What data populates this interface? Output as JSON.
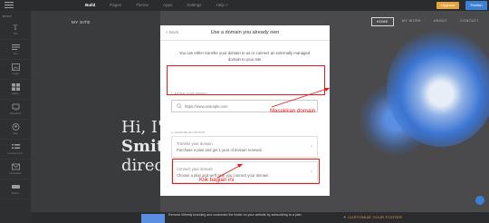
{
  "topbar": {
    "tabs": [
      {
        "label": "Build",
        "active": true
      },
      {
        "label": "Pages",
        "active": false
      },
      {
        "label": "Theme",
        "active": false
      },
      {
        "label": "Apps",
        "active": false
      },
      {
        "label": "Settings",
        "active": false
      },
      {
        "label": "Help ˅",
        "active": false
      }
    ],
    "upgrade_label": "Upgrade",
    "publish_label": "Publish"
  },
  "sidebar": {
    "header": "BASIC",
    "items": [
      {
        "icon": "text-icon",
        "label": "Title"
      },
      {
        "icon": "paragraph-icon",
        "label": "Text"
      },
      {
        "icon": "image-icon",
        "label": "Image"
      },
      {
        "icon": "gallery-icon",
        "label": "Gallery"
      },
      {
        "icon": "slideshow-icon",
        "label": "Slideshow"
      },
      {
        "icon": "map-icon",
        "label": "Map"
      },
      {
        "icon": "form-icon",
        "label": "Contact Form"
      },
      {
        "icon": "newsletter-icon",
        "label": "Newsletter"
      },
      {
        "icon": "button-icon",
        "label": "Button"
      }
    ]
  },
  "site": {
    "title": "MY SITE",
    "nav": [
      {
        "label": "HOME",
        "active": true
      },
      {
        "label": "MY WORK",
        "active": false
      },
      {
        "label": "ABOUT",
        "active": false
      },
      {
        "label": "CONTACT",
        "active": false
      }
    ],
    "hero_line1": "Hi, I'",
    "hero_line2": "Smit",
    "hero_line3": "direc"
  },
  "modal": {
    "back_label": "< Back",
    "title": "Use a domain you already own",
    "intro": "You can either transfer your domain to us or connect an externally managed domain to your site",
    "section1_label": "1. ENTER YOUR DOMAIN",
    "input_placeholder": "https://www.example.com",
    "section2_label": "2. CHOOSE AN OPTION",
    "options": [
      {
        "title": "Transfer your domain",
        "desc": "Purchase a plan and get 1 year of domain renewal."
      },
      {
        "title": "Connect your domain",
        "desc": "Choose a plan and we'll help you connect your domain."
      }
    ]
  },
  "annotations": {
    "masukkan": "Masukkan domain",
    "klik": "Klik bagian ini",
    "color": "#e41b1b"
  },
  "footer": {
    "text": "Remove Weebly branding and customize the footer on your website by subscribing to a plan.",
    "customize": "✦ CUSTOMIZE YOUR FOOTER"
  },
  "colors": {
    "accent": "#3c80d6",
    "upgrade": "#e2a341"
  }
}
